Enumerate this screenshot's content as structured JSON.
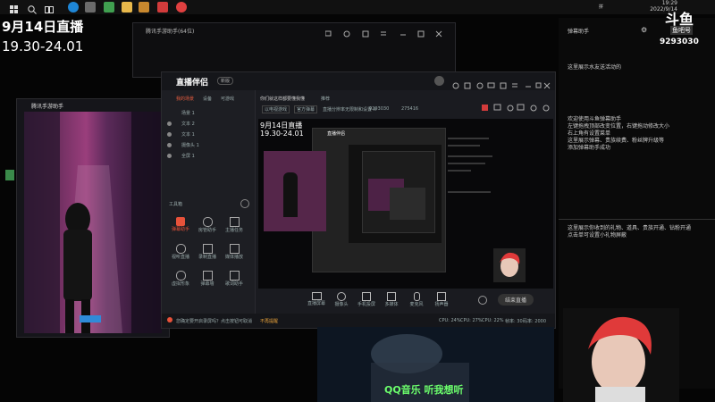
{
  "taskbar": {
    "clock_time": "19:29",
    "clock_date": "2022/9/14",
    "lang": "拼",
    "icons": [
      "start-icon",
      "search-icon",
      "task-view-icon",
      "edge-browser-icon",
      "wechat-icon",
      "app-icon",
      "folder-icon",
      "record-icon",
      "recorder-icon"
    ]
  },
  "overlay": {
    "title": "9月14日直播",
    "time_range": "19.30-24.01",
    "qq_music_text": "QQ音乐  听我想听"
  },
  "watermark": {
    "brand": "斗鱼",
    "sub": "鱼吧号",
    "room_id": "9293030"
  },
  "right_panel": {
    "header_label": "弹幕助手",
    "gear_label": "⚙",
    "lines_top": [
      "这里展示水友送活动的"
    ],
    "lines_welcome": [
      "欢迎使用斗鱼弹幕助手",
      "左键拖拽顶部改变位置，右键拖动修改大小",
      "右上角有设置菜单",
      "这里展示弹幕、贵族续费、粉丝牌升级等",
      "添加弹幕助手成功"
    ],
    "lines_bottom": [
      "这里展示你收到的礼物、道具、贵族开通、钻粉开通",
      "点击单可设置小礼物屏蔽"
    ]
  },
  "assistant_window": {
    "title": "腾讯手游助手(64位)"
  },
  "phone_window": {
    "title": "腾讯手游助手"
  },
  "obs_window": {
    "brand": "直播伴侣",
    "edition_tag": "新版",
    "tabs": [
      "我的场景",
      "设备",
      "可游戏"
    ],
    "scenes": [
      "文本 2",
      "文本 1",
      "摄像头 1",
      "全屏 1"
    ],
    "scene_root": "场景 1",
    "topbar_texts": [
      "你们就这样都要懂我懂",
      "推荐",
      "以电视游戏",
      "官方弹幕",
      "直播分辨率无限制和设置 X",
      "9293030",
      "275416"
    ],
    "toolkit_label": "工具箱",
    "tools": [
      {
        "label": "弹幕助手",
        "icon": "danmaku-icon",
        "active": true
      },
      {
        "label": "房管助手",
        "icon": "room-manager-icon",
        "active": false
      },
      {
        "label": "主播任务",
        "icon": "task-icon",
        "active": false
      },
      {
        "label": "视听直播",
        "icon": "video-live-icon",
        "active": false
      },
      {
        "label": "录制直播",
        "icon": "record-live-icon",
        "active": false
      },
      {
        "label": "媒体播放",
        "icon": "media-icon",
        "active": false
      },
      {
        "label": "虚拟形象",
        "icon": "avatar-icon",
        "active": false
      },
      {
        "label": "弹幕墙",
        "icon": "danmaku-wall-icon",
        "active": false
      },
      {
        "label": "歌词助手",
        "icon": "lyrics-icon",
        "active": false
      }
    ],
    "bottom_tools": [
      {
        "label": "直播屏幕",
        "icon": "screen-icon"
      },
      {
        "label": "摄像头",
        "icon": "camera-icon"
      },
      {
        "label": "手机投屏",
        "icon": "phone-cast-icon"
      },
      {
        "label": "多媒体",
        "icon": "multimedia-icon"
      },
      {
        "label": "麦克风",
        "icon": "mic-icon"
      },
      {
        "label": "扬声器",
        "icon": "speaker-icon"
      }
    ],
    "start_button": "结束直播",
    "status_texts": [
      "CPU: 24%",
      "CPU: 27%",
      "CPU: 22%",
      "帧率: 30",
      "码率: 2000"
    ],
    "notice_text": "您确定要开启录屏吗？点击按钮可取消",
    "notice_link": "不再提醒"
  }
}
